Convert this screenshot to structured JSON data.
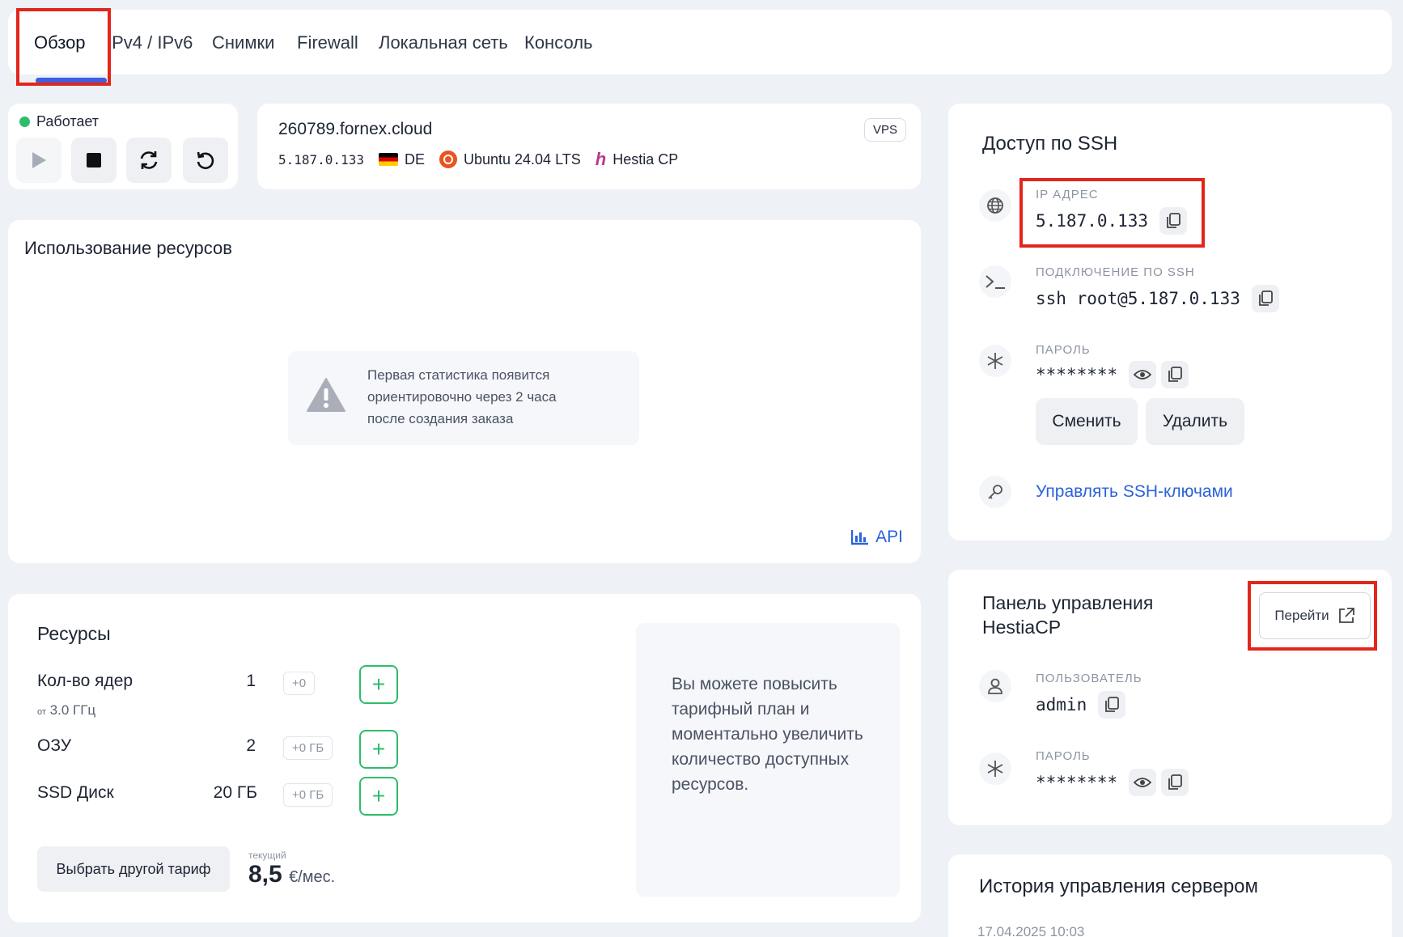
{
  "tabs": [
    "Обзор",
    "IPv4 / IPv6",
    "Снимки",
    "Firewall",
    "Локальная сеть",
    "Консоль"
  ],
  "status": {
    "text": "Работает"
  },
  "server": {
    "hostname": "260789.fornex.cloud",
    "ip": "5.187.0.133",
    "country": "DE",
    "os": "Ubuntu 24.04 LTS",
    "panel": "Hestia CP",
    "badge": "VPS"
  },
  "usage": {
    "title": "Использование ресурсов",
    "notice_line1": "Первая статистика появится",
    "notice_line2": "ориентировочно через 2 часа",
    "notice_line3": "после создания заказа",
    "api_label": "API"
  },
  "resources": {
    "title": "Ресурсы",
    "cores_label": "Кол-во ядер",
    "cores_value": "1",
    "cores_delta": "+0",
    "cores_freq_prefix": "от",
    "cores_freq": "3.0 ГГц",
    "ram_label": "ОЗУ",
    "ram_value": "2",
    "ram_delta": "+0 ГБ",
    "disk_label": "SSD Диск",
    "disk_value": "20 ГБ",
    "disk_delta": "+0 ГБ",
    "change_plan_button": "Выбрать другой тариф",
    "current_label": "текущий",
    "price_value": "8,5",
    "price_unit": "€/мес.",
    "upgrade_text": "Вы можете повысить тарифный план и моментально увеличить количество доступных ресурсов."
  },
  "ssh": {
    "title": "Доступ по SSH",
    "ip_label": "IP АДРЕС",
    "ip_value": "5.187.0.133",
    "conn_label": "ПОДКЛЮЧЕНИЕ ПО SSH",
    "conn_value": "ssh root@5.187.0.133",
    "password_label": "ПАРОЛЬ",
    "password_value": "********",
    "change_button": "Сменить",
    "delete_button": "Удалить",
    "keys_link": "Управлять SSH-ключами"
  },
  "panel": {
    "title_line1": "Панель управления",
    "title_line2": "HestiaCP",
    "goto_button": "Перейти",
    "user_label": "ПОЛЬЗОВАТЕЛЬ",
    "user_value": "admin",
    "password_label": "ПАРОЛЬ",
    "password_value": "********"
  },
  "history": {
    "title": "История управления сервером",
    "first_date": "17.04.2025 10:03"
  },
  "colors": {
    "accent": "#3d5fe0",
    "link": "#2b63d9",
    "success": "#2ebd6b",
    "highlight": "#e2261c"
  }
}
